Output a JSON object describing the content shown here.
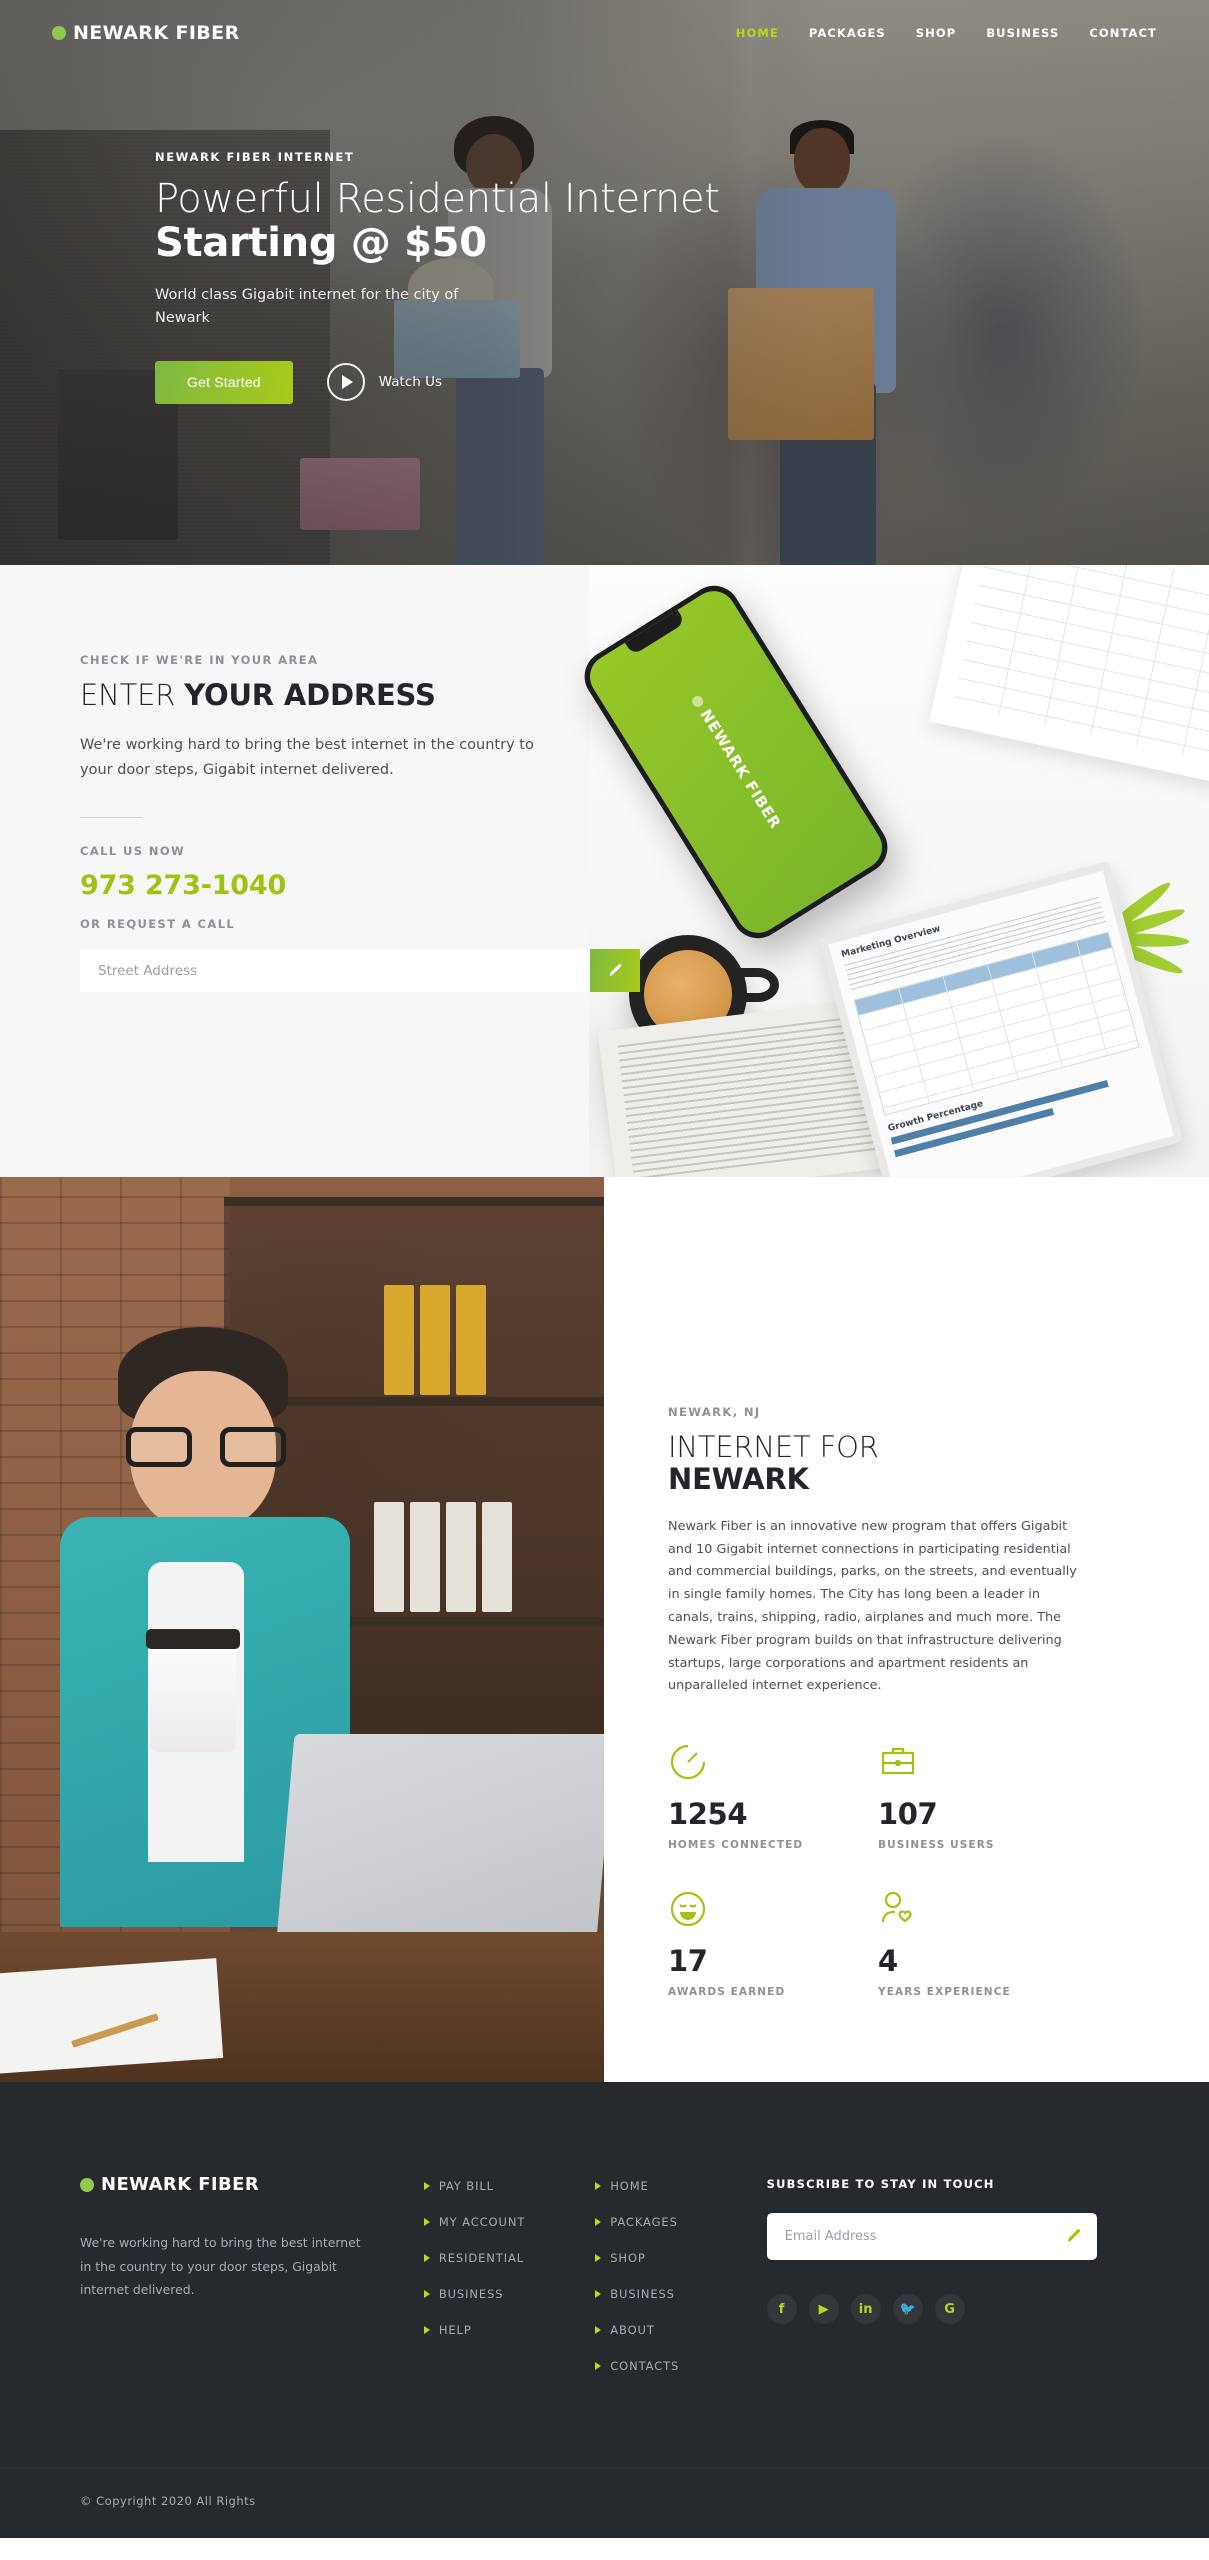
{
  "brand": {
    "name": "NEWARK FIBER",
    "accent_green": "#9ec413",
    "dark": "#262a2e"
  },
  "nav": {
    "items": [
      {
        "label": "HOME",
        "active": true
      },
      {
        "label": "PACKAGES",
        "active": false
      },
      {
        "label": "SHOP",
        "active": false
      },
      {
        "label": "BUSINESS",
        "active": false
      },
      {
        "label": "CONTACT",
        "active": false
      }
    ]
  },
  "hero": {
    "eyebrow": "NEWARK FIBER INTERNET",
    "title_line1": "Powerful Residential Internet",
    "title_line2": "Starting @ $50",
    "subtitle": "World class Gigabit internet for the city of Newark",
    "primary_button": "Get Started",
    "video_label": "Watch Us"
  },
  "address": {
    "eyebrow": "CHECK IF WE'RE IN YOUR AREA",
    "heading_light": "ENTER ",
    "heading_bold": "YOUR ADDRESS",
    "description": "We're working hard to bring the best internet in the country to your door steps, Gigabit internet delivered.",
    "call_label": "CALL US NOW",
    "phone": "973 273-1040",
    "request_label": "OR REQUEST A CALL",
    "input_placeholder": "Street Address",
    "input_value": "",
    "submit_icon": "pencil-icon",
    "phone_mock_brand": "NEWARK FIBER",
    "tablet_title": "Marketing Overview",
    "tablet_title2": "Growth Percentage"
  },
  "newark": {
    "eyebrow": "NEWARK, NJ",
    "heading_light": "INTERNET FOR",
    "heading_bold": "NEWARK",
    "paragraph": "Newark Fiber is an innovative new program that offers Gigabit and 10 Gigabit internet connections in participating residential and commercial buildings, parks, on the streets, and eventually in single family homes. The City has long been a leader in canals, trains, shipping, radio, airplanes and much more. The Newark Fiber program builds on that infrastructure delivering startups, large corporations and apartment residents an unparalleled internet experience.",
    "stats": [
      {
        "value": "1254",
        "label": "HOMES CONNECTED",
        "icon": "speedometer-icon"
      },
      {
        "value": "107",
        "label": "BUSINESS USERS",
        "icon": "briefcase-icon"
      },
      {
        "value": "17",
        "label": "AWARDS EARNED",
        "icon": "smiley-icon"
      },
      {
        "value": "4",
        "label": "YEARS EXPERIENCE",
        "icon": "person-heart-icon"
      }
    ]
  },
  "footer": {
    "logo": "NEWARK FIBER",
    "description": "We're working hard to bring the best internet in the country to your door steps, Gigabit internet delivered.",
    "column1": [
      {
        "label": "PAY BILL"
      },
      {
        "label": "MY ACCOUNT"
      },
      {
        "label": "RESIDENTIAL"
      },
      {
        "label": "BUSINESS"
      },
      {
        "label": "HELP"
      }
    ],
    "column2": [
      {
        "label": "HOME"
      },
      {
        "label": "PACKAGES"
      },
      {
        "label": "SHOP"
      },
      {
        "label": "BUSINESS"
      },
      {
        "label": "ABOUT"
      },
      {
        "label": "CONTACTS"
      }
    ],
    "subscribe_title": "SUBSCRIBE TO STAY IN TOUCH",
    "email_placeholder": "Email Address",
    "email_value": "",
    "socials": [
      {
        "name": "facebook-icon",
        "glyph": "f"
      },
      {
        "name": "youtube-icon",
        "glyph": "▶"
      },
      {
        "name": "linkedin-icon",
        "glyph": "in"
      },
      {
        "name": "twitter-icon",
        "glyph": "🐦"
      },
      {
        "name": "google-icon",
        "glyph": "G"
      }
    ],
    "copyright": "© Copyright 2020 All Rights"
  }
}
